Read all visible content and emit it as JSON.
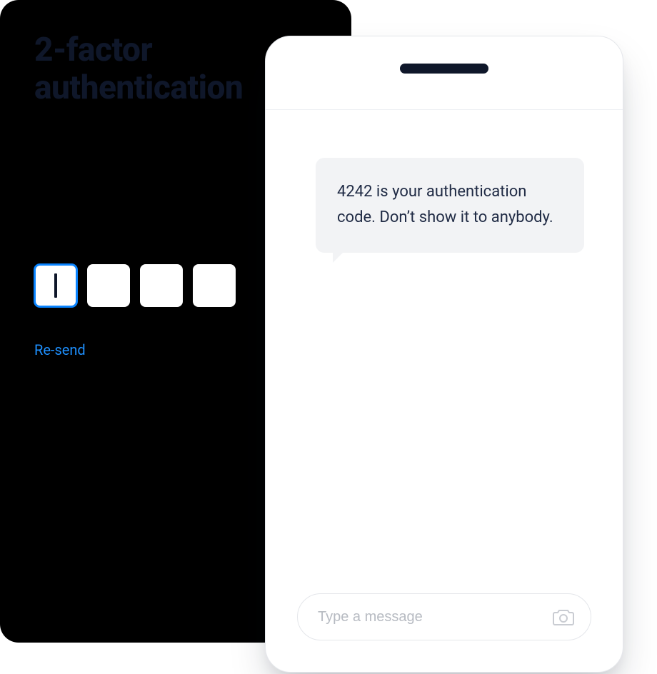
{
  "auth": {
    "title_line1": "2-factor",
    "title_line2": "authentication",
    "code_digits": [
      "",
      "",
      "",
      ""
    ],
    "resend_label": "Re-send"
  },
  "phone": {
    "sms_text": "4242 is your authentication code. Don’t show it to anybody.",
    "composer_placeholder": "Type a message"
  },
  "colors": {
    "accent": "#0A84FF",
    "darkText": "#0F172A",
    "bubble": "#F2F3F5"
  }
}
